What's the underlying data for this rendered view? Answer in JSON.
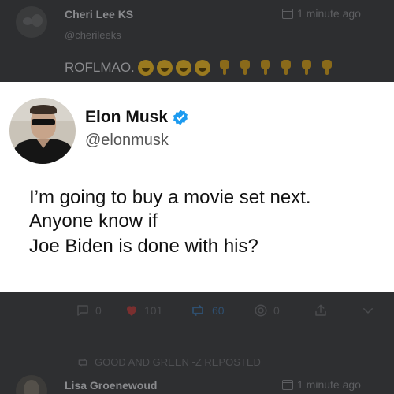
{
  "post1": {
    "author": "Cheri Lee KS",
    "handle": "@cherileeks",
    "time": "1 minute ago",
    "text": "ROFLMAO."
  },
  "tweet": {
    "name": "Elon Musk",
    "handle": "@elonmusk",
    "lines": [
      "I’m going to buy a movie set next.",
      "Anyone know if",
      "Joe Biden is done with his?"
    ]
  },
  "actions": {
    "replies": "0",
    "likes": "101",
    "reposts": "60",
    "views": "0"
  },
  "post2": {
    "repost_label": "GOOD AND GREEN -Z REPOSTED",
    "author": "Lisa Groenewoud",
    "time": "1 minute ago"
  },
  "colors": {
    "background": "#2e2f31",
    "card": "#ffffff",
    "verified": "#1d9bf0",
    "like": "#7a2f2f",
    "repost": "#2f4f6f"
  },
  "icons": [
    "calendar-icon",
    "laughing-emoji-icon",
    "pointing-down-emoji-icon",
    "verified-badge-icon",
    "reply-icon",
    "heart-icon",
    "repost-icon",
    "views-icon",
    "share-icon",
    "chevron-down-icon"
  ]
}
